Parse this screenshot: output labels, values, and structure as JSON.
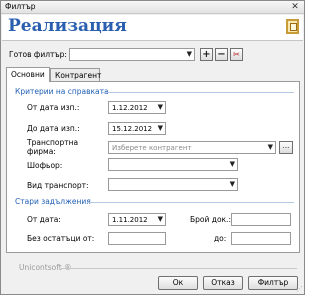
{
  "window": {
    "title": "Филтър",
    "close_symbol": "✕"
  },
  "header": {
    "title": "Реализация",
    "logo_icon": "unicontsoft-logo"
  },
  "preset": {
    "label": "Готов филтър:",
    "value": "",
    "add_symbol": "+",
    "remove_symbol": "−",
    "clear_symbol": "✂"
  },
  "tabs": [
    {
      "label": "Основни",
      "active": true
    },
    {
      "label": "Контрагент",
      "active": false
    }
  ],
  "criteria": {
    "title": "Критерии на справката",
    "date_from_label": "От дата изп.:",
    "date_from_value": "1.12.2012",
    "date_to_label": "До дата изп.:",
    "date_to_value": "15.12.2012",
    "company_label_1": "Транспортна",
    "company_label_2": "фирма:",
    "company_placeholder": "Изберете контрагент",
    "driver_label": "Шофьор:",
    "driver_value": "",
    "transport_label": "Вид транспорт:",
    "transport_value": ""
  },
  "old": {
    "title": "Стари задължения",
    "from_date_label": "От дата:",
    "from_date_value": "1.11.2012",
    "no_remainder_label": "Без остатъци от:",
    "no_remainder_value": "",
    "docs_label": "Брой док.:",
    "docs_value": "",
    "to_label": "до:",
    "to_value": ""
  },
  "footer": {
    "brand": "Unicontsoft ®",
    "ok": "Ок",
    "cancel": "Отказ",
    "filter": "Филтър"
  },
  "colors": {
    "accent": "#1f5fb4",
    "header_title": "#2a5fb0"
  }
}
